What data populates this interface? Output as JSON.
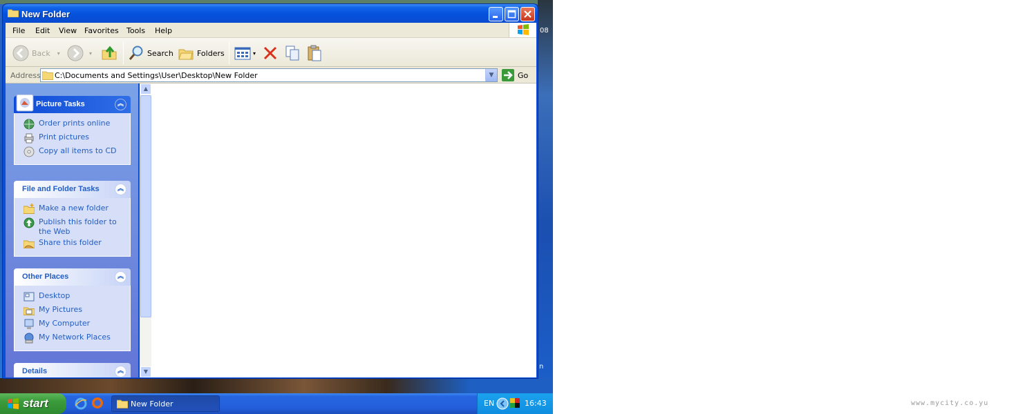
{
  "window": {
    "title": "New Folder"
  },
  "menu": [
    "File",
    "Edit",
    "View",
    "Favorites",
    "Tools",
    "Help"
  ],
  "toolbar": {
    "back": "Back",
    "search": "Search",
    "folders": "Folders"
  },
  "address": {
    "label": "Address",
    "path": "C:\\Documents and Settings\\User\\Desktop\\New Folder",
    "go": "Go"
  },
  "panels": {
    "picture_tasks": {
      "title": "Picture Tasks",
      "items": [
        "Order prints online",
        "Print pictures",
        "Copy all items to CD"
      ]
    },
    "file_folder_tasks": {
      "title": "File and Folder Tasks",
      "items": [
        "Make a new folder",
        "Publish this folder to the Web",
        "Share this folder"
      ]
    },
    "other_places": {
      "title": "Other Places",
      "items": [
        "Desktop",
        "My Pictures",
        "My Computer",
        "My Network Places"
      ]
    },
    "details": {
      "title": "Details"
    }
  },
  "taskbar": {
    "start": "start",
    "active_task": "New Folder",
    "language": "EN",
    "clock": "16:43"
  },
  "desktop_fragments": [
    "08",
    "n"
  ],
  "watermark": "www.mycity.co.yu",
  "colors": {
    "xp_blue": "#0a4fd8",
    "task_link": "#215dc6",
    "start_green": "#3b9a3b"
  }
}
